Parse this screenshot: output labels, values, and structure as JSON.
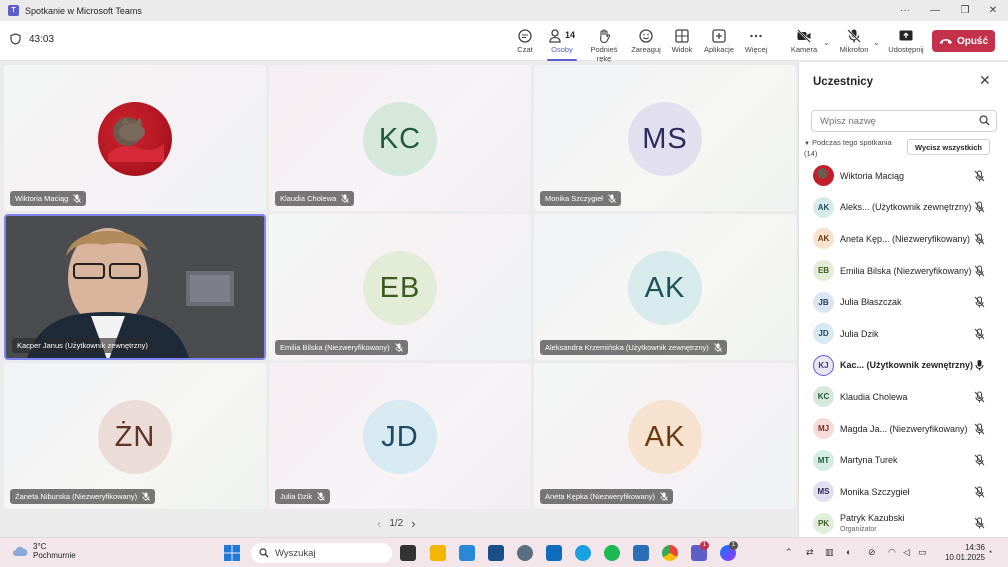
{
  "window": {
    "title": "Spotkanie w Microsoft Teams",
    "more": "···"
  },
  "meeting": {
    "timer": "43:03"
  },
  "toolbar": {
    "chat": "Czat",
    "people": "Osoby",
    "people_count": "14",
    "raise_hand": "Podnieś rękę",
    "react": "Zareaguj",
    "view": "Widok",
    "apps": "Aplikacje",
    "more": "Więcej",
    "camera": "Kamera",
    "mic": "Mikrofon",
    "share": "Udostępnij",
    "leave": "Opuść"
  },
  "tiles": [
    {
      "name": "Wiktoria Maciąg",
      "initials": "",
      "type": "photo",
      "bg": "#c41e2a",
      "fg": "#ffffff"
    },
    {
      "name": "Klaudia Cholewa",
      "initials": "KC",
      "type": "avatar",
      "bg": "#d6e8dc",
      "fg": "#1f5a3a"
    },
    {
      "name": "Monika Szczygieł",
      "initials": "MS",
      "type": "avatar",
      "bg": "#e2e0ef",
      "fg": "#2f2a5c"
    },
    {
      "name": "Kacper Janus (Użytkownik zewnętrzny)",
      "initials": "",
      "type": "video",
      "bg": "#3a3c40",
      "fg": "#ffffff"
    },
    {
      "name": "Emilia Bilska (Niezweryfikowany)",
      "initials": "EB",
      "type": "avatar",
      "bg": "#e3ecd6",
      "fg": "#3d5a21"
    },
    {
      "name": "Aleksandra Krzemińska (Użytkownik zewnętrzny)",
      "initials": "AK",
      "type": "avatar",
      "bg": "#d7ebec",
      "fg": "#1d5257"
    },
    {
      "name": "Żaneta Niburska (Niezweryfikowany)",
      "initials": "ŻN",
      "type": "avatar",
      "bg": "#ecdcd7",
      "fg": "#5c3326"
    },
    {
      "name": "Julia Dzik",
      "initials": "JD",
      "type": "avatar",
      "bg": "#d8eaf1",
      "fg": "#1c4a5e"
    },
    {
      "name": "Aneta Kępka (Niezweryfikowany)",
      "initials": "AK",
      "type": "avatar",
      "bg": "#f7e2cf",
      "fg": "#6b3b12"
    }
  ],
  "pager": {
    "label": "1/2",
    "prev": "‹",
    "next": "›"
  },
  "panel": {
    "title": "Uczestnicy",
    "search_placeholder": "Wpisz nazwę",
    "section": "Podczas tego spotkania (14)",
    "mute_all": "Wycisz wszystkich",
    "participants": [
      {
        "initials": "",
        "name": "Wiktoria Maciąg",
        "bg": "#c41e2a",
        "fg": "#fff",
        "bold": false,
        "mic": "muted",
        "sub": ""
      },
      {
        "initials": "AK",
        "name": "Aleks... (Użytkownik zewnętrzny)",
        "bg": "#d7ebec",
        "fg": "#1d5257",
        "bold": false,
        "mic": "muted",
        "sub": ""
      },
      {
        "initials": "AK",
        "name": "Aneta Kęp... (Niezweryfikowany)",
        "bg": "#f7e2cf",
        "fg": "#6b3b12",
        "bold": false,
        "mic": "muted",
        "sub": ""
      },
      {
        "initials": "EB",
        "name": "Emilia Bilska (Niezweryfikowany)",
        "bg": "#e3ecd6",
        "fg": "#3d5a21",
        "bold": false,
        "mic": "muted",
        "sub": ""
      },
      {
        "initials": "JB",
        "name": "Julia Błaszczak",
        "bg": "#dce6f3",
        "fg": "#23406b",
        "bold": false,
        "mic": "muted",
        "sub": ""
      },
      {
        "initials": "JD",
        "name": "Julia Dzik",
        "bg": "#d8eaf1",
        "fg": "#1c4a5e",
        "bold": false,
        "mic": "muted",
        "sub": ""
      },
      {
        "initials": "KJ",
        "name": "Kac... (Użytkownik zewnętrzny)",
        "bg": "#e8e6f5",
        "fg": "#3b3a8a",
        "bold": true,
        "mic": "on",
        "sub": ""
      },
      {
        "initials": "KC",
        "name": "Klaudia Cholewa",
        "bg": "#d6e8dc",
        "fg": "#1f5a3a",
        "bold": false,
        "mic": "muted",
        "sub": ""
      },
      {
        "initials": "MJ",
        "name": "Magda Ja... (Niezweryfikowany)",
        "bg": "#f6dcd9",
        "fg": "#7a2a22",
        "bold": false,
        "mic": "muted",
        "sub": ""
      },
      {
        "initials": "MT",
        "name": "Martyna Turek",
        "bg": "#d5ece1",
        "fg": "#1e5a3f",
        "bold": false,
        "mic": "muted",
        "sub": ""
      },
      {
        "initials": "MS",
        "name": "Monika Szczygieł",
        "bg": "#e2e0ef",
        "fg": "#2f2a5c",
        "bold": false,
        "mic": "muted",
        "sub": ""
      },
      {
        "initials": "PK",
        "name": "Patryk Kazubski",
        "bg": "#e1eedb",
        "fg": "#3a5a25",
        "bold": false,
        "mic": "muted",
        "sub": "Organizator"
      }
    ]
  },
  "taskbar": {
    "temp": "3°C",
    "weather": "Pochmurnie",
    "search": "Wyszukaj",
    "time": "14:36",
    "date": "10.01.2025",
    "badge_teams": "1",
    "badge_msgr": "1"
  }
}
